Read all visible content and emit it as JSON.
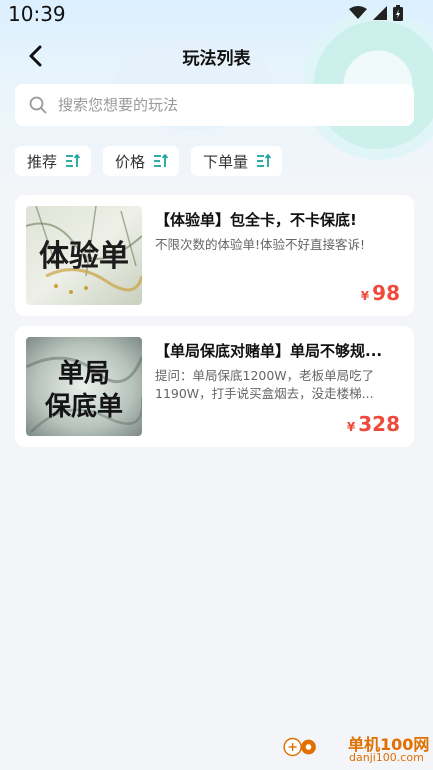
{
  "status_bar": {
    "time": "10:39"
  },
  "header": {
    "title": "玩法列表"
  },
  "search": {
    "placeholder": "搜索您想要的玩法"
  },
  "filters": [
    {
      "label": "推荐"
    },
    {
      "label": "价格"
    },
    {
      "label": "下单量"
    }
  ],
  "products": [
    {
      "thumb_text": "体验单",
      "title": "【体验单】包全卡，不卡保底!",
      "desc": "不限次数的体验单!体验不好直接客诉!",
      "currency": "¥",
      "price": "98"
    },
    {
      "thumb_text_line1": "单局",
      "thumb_text_line2": "保底单",
      "title": "【单局保底对赌单】单局不够规...",
      "desc": "提问：单局保底1200W，老板单局吃了1190W，打手说买盒烟去，没走楼梯...",
      "currency": "¥",
      "price": "328"
    }
  ],
  "watermark": {
    "title": "单机100网",
    "url": "danji100.com"
  },
  "colors": {
    "price": "#f04a3c",
    "accent_teal": "#1aa59a",
    "background": "#f4f5f9"
  }
}
